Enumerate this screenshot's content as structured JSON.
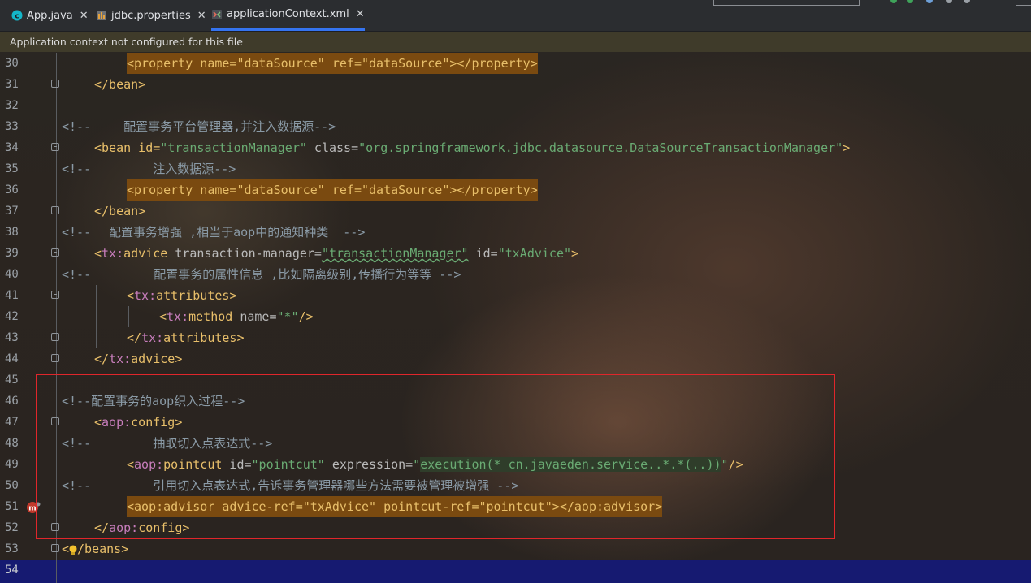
{
  "tabs": [
    {
      "label": "App.java",
      "icon": "java-class-icon",
      "close": "✕"
    },
    {
      "label": "jdbc.properties",
      "icon": "properties-file-icon",
      "close": "✕"
    },
    {
      "label": "applicationContext.xml",
      "icon": "xml-file-icon",
      "close": "✕"
    }
  ],
  "banner": {
    "text": "Application context not configured for this file"
  },
  "lines": [
    {
      "n": "30",
      "p": [
        "    ",
        "<property name=\"dataSource\" ref=\"dataSource\"></property>"
      ]
    },
    {
      "n": "31",
      "p": [
        "",
        "</bean>"
      ]
    },
    {
      "n": "32",
      "p": []
    },
    {
      "n": "33",
      "p": [
        "<!--",
        "    配置事务平台管理器,并注入数据源-->"
      ]
    },
    {
      "n": "34",
      "p": [
        "<bean id=",
        "\"transactionManager\"",
        " class=",
        "\"org.springframework.jdbc.datasource.DataSourceTransactionManager\"",
        ">"
      ]
    },
    {
      "n": "35",
      "p": [
        "<!--",
        "        注入数据源-->"
      ]
    },
    {
      "n": "36",
      "p": [
        "<property name=\"dataSource\" ref=\"dataSource\"></property>"
      ]
    },
    {
      "n": "37",
      "p": [
        "</bean>"
      ]
    },
    {
      "n": "38",
      "p": [
        "<!--",
        "  配置事务增强 ,相当于aop中的通知种类  -->"
      ]
    },
    {
      "n": "39",
      "p": [
        "<",
        "tx:",
        "advice",
        " transaction-manager=",
        "\"transactionManager\"",
        " id=",
        "\"txAdvice\"",
        ">"
      ]
    },
    {
      "n": "40",
      "p": [
        "<!--",
        "       配置事务的属性信息 ,比如隔离级别,传播行为等等 -->"
      ]
    },
    {
      "n": "41",
      "p": [
        "<",
        "tx:",
        "attributes",
        ">"
      ]
    },
    {
      "n": "42",
      "p": [
        "<",
        "tx:",
        "method",
        " name=",
        "\"*\"",
        "/>"
      ]
    },
    {
      "n": "43",
      "p": [
        "</",
        "tx:",
        "attributes",
        ">"
      ]
    },
    {
      "n": "44",
      "p": [
        "</",
        "tx:",
        "advice",
        ">"
      ]
    },
    {
      "n": "45",
      "p": []
    },
    {
      "n": "46",
      "p": [
        "<!--配置事务的aop织入过程-->"
      ]
    },
    {
      "n": "47",
      "p": [
        "<",
        "aop:",
        "config",
        ">"
      ]
    },
    {
      "n": "48",
      "p": [
        "<!--",
        "        抽取切入点表达式-->"
      ]
    },
    {
      "n": "49",
      "p": [
        "<",
        "aop:",
        "pointcut",
        " id=",
        "\"pointcut\"",
        " expression=",
        "\"",
        "execution(* cn.javaeden.service..*.*(..))",
        "\"",
        "/>"
      ]
    },
    {
      "n": "50",
      "p": [
        "<!--",
        "        引用切入点表达式,告诉事务管理器哪些方法需要被管理被增强 -->"
      ]
    },
    {
      "n": "51",
      "p": [
        "<aop:advisor advice-ref=\"txAdvice\" pointcut-ref=\"pointcut\"></aop:advisor>"
      ]
    },
    {
      "n": "52",
      "p": [
        "</",
        "aop:",
        "config",
        ">"
      ]
    },
    {
      "n": "53",
      "p": [
        "<",
        "/beans",
        ">"
      ]
    },
    {
      "n": "54",
      "p": []
    }
  ]
}
